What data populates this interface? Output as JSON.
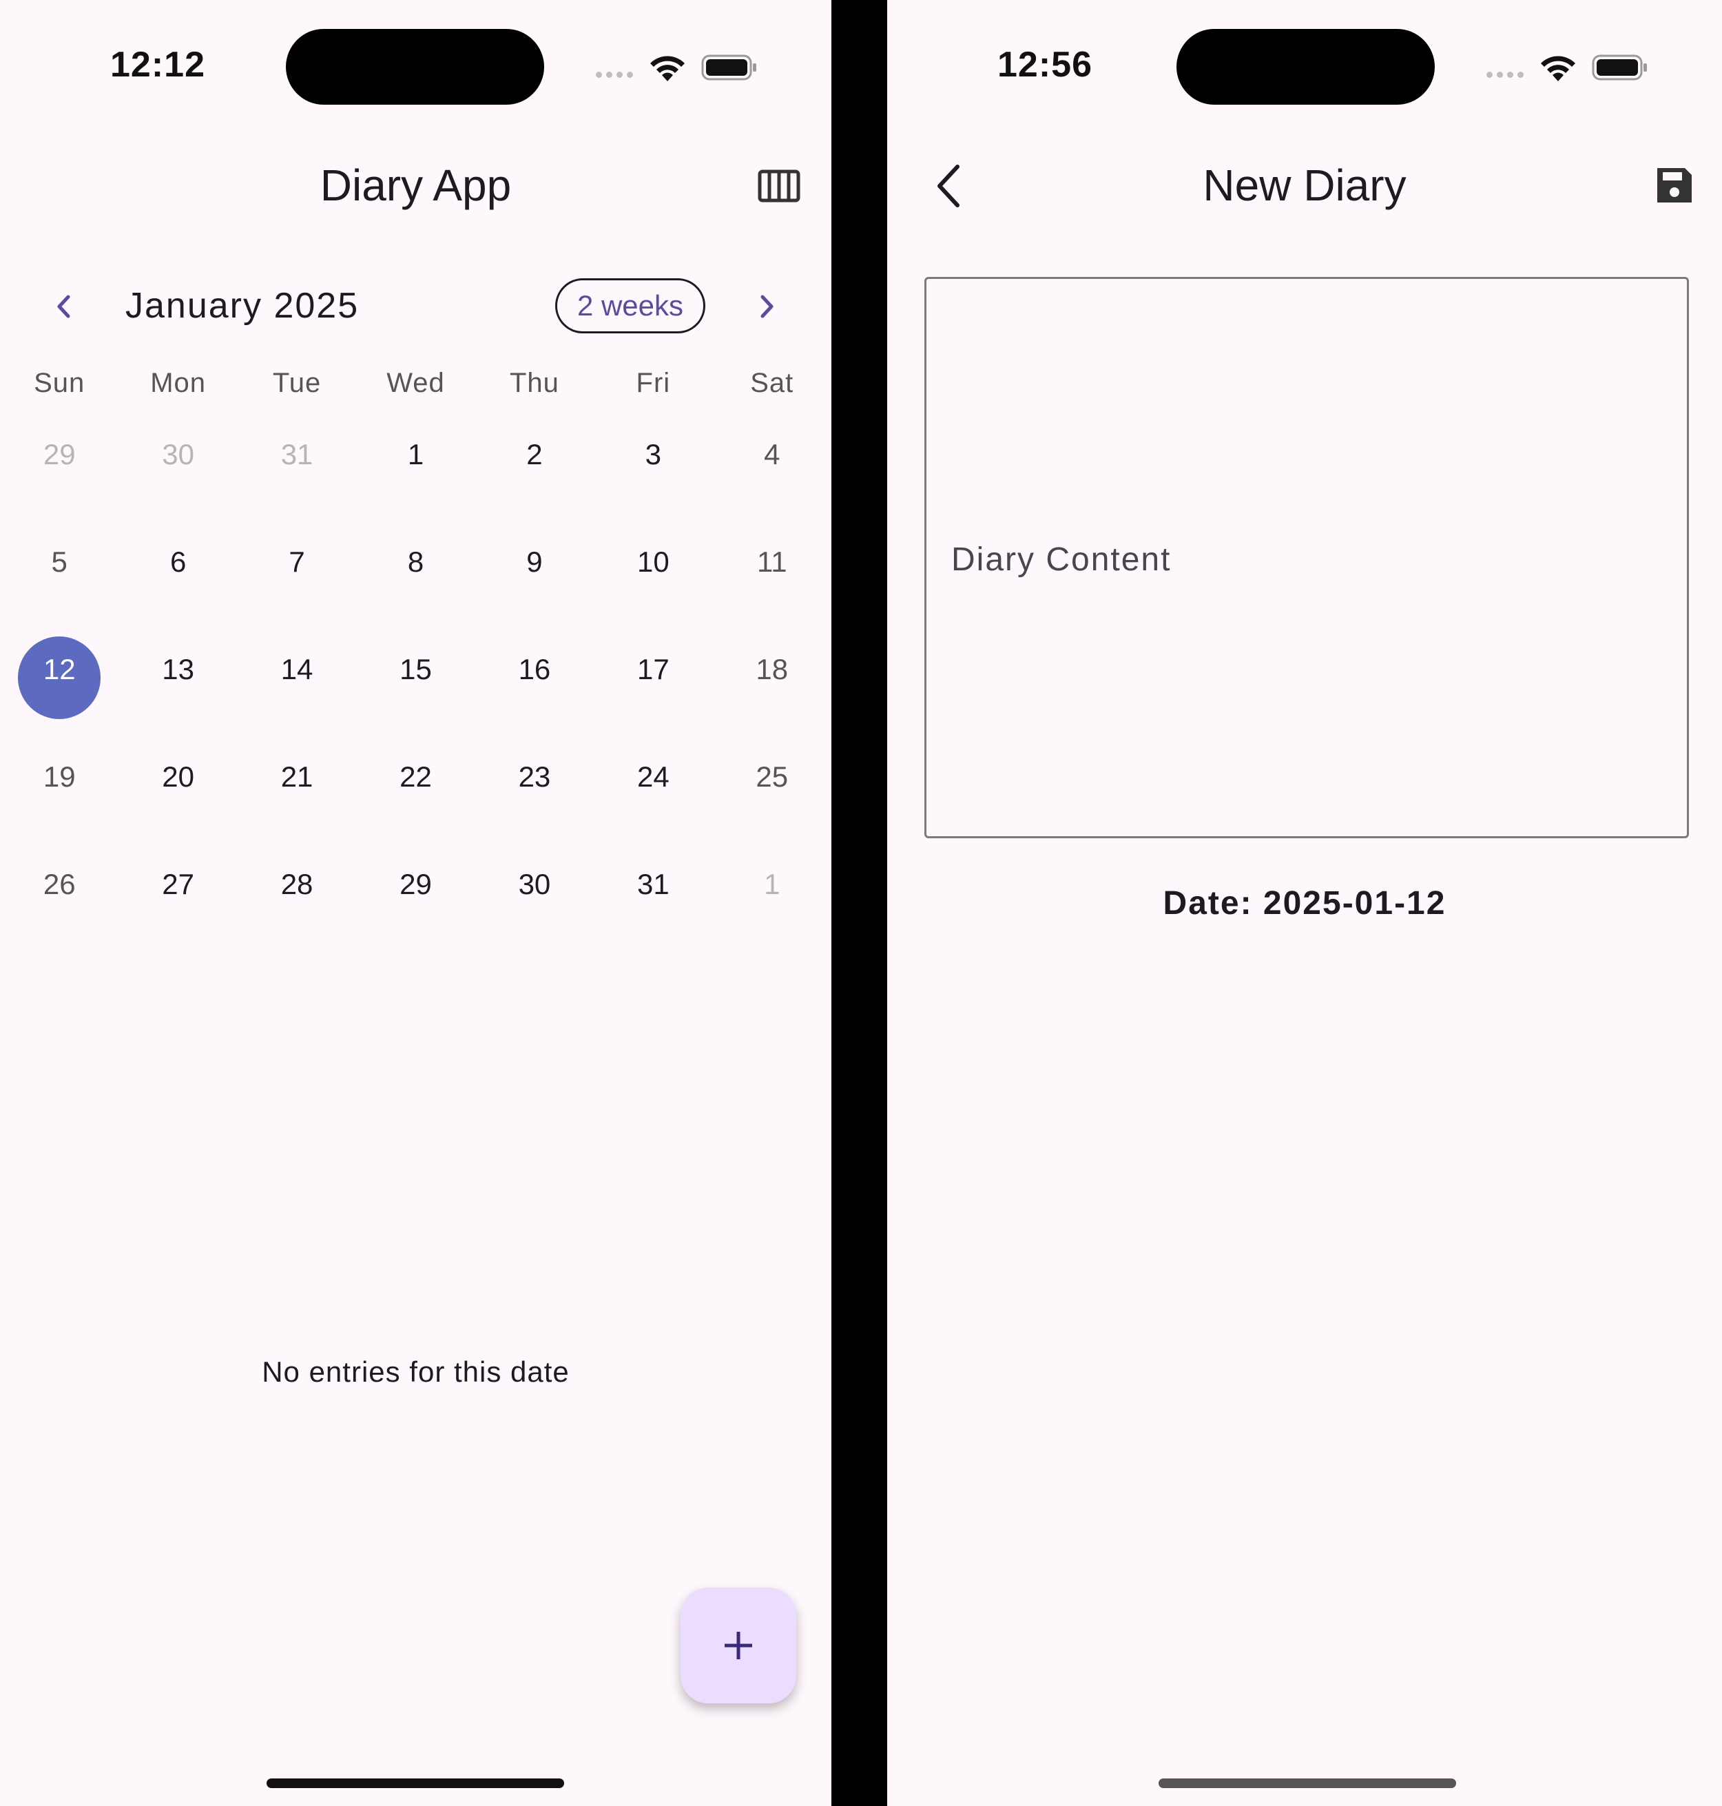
{
  "left": {
    "status": {
      "time": "12:12"
    },
    "appbar": {
      "title": "Diary App",
      "format_icon": "view-week-icon"
    },
    "calendar": {
      "month": "January 2025",
      "format_button": "2 weeks",
      "prev_icon": "chevron-left-icon",
      "next_icon": "chevron-right-icon",
      "days_of_week": [
        "Sun",
        "Mon",
        "Tue",
        "Wed",
        "Thu",
        "Fri",
        "Sat"
      ],
      "weeks": [
        [
          "29",
          "30",
          "31",
          "1",
          "2",
          "3",
          "4"
        ],
        [
          "5",
          "6",
          "7",
          "8",
          "9",
          "10",
          "11"
        ],
        [
          "12",
          "13",
          "14",
          "15",
          "16",
          "17",
          "18"
        ],
        [
          "19",
          "20",
          "21",
          "22",
          "23",
          "24",
          "25"
        ],
        [
          "26",
          "27",
          "28",
          "29",
          "30",
          "31",
          "1"
        ]
      ],
      "selected_day": "12"
    },
    "empty_message": "No entries for this date",
    "fab_icon": "plus-icon",
    "colors": {
      "selected": "#5C6BC0",
      "fab": "#EADDFF",
      "accent": "#5B4B9E",
      "background": "#FEF7FC"
    }
  },
  "right": {
    "status": {
      "time": "12:56"
    },
    "appbar": {
      "title": "New Diary",
      "back_icon": "back-arrow-icon",
      "save_icon": "save-icon"
    },
    "content_placeholder": "Diary Content",
    "date_label": "Date: 2025-01-12"
  }
}
